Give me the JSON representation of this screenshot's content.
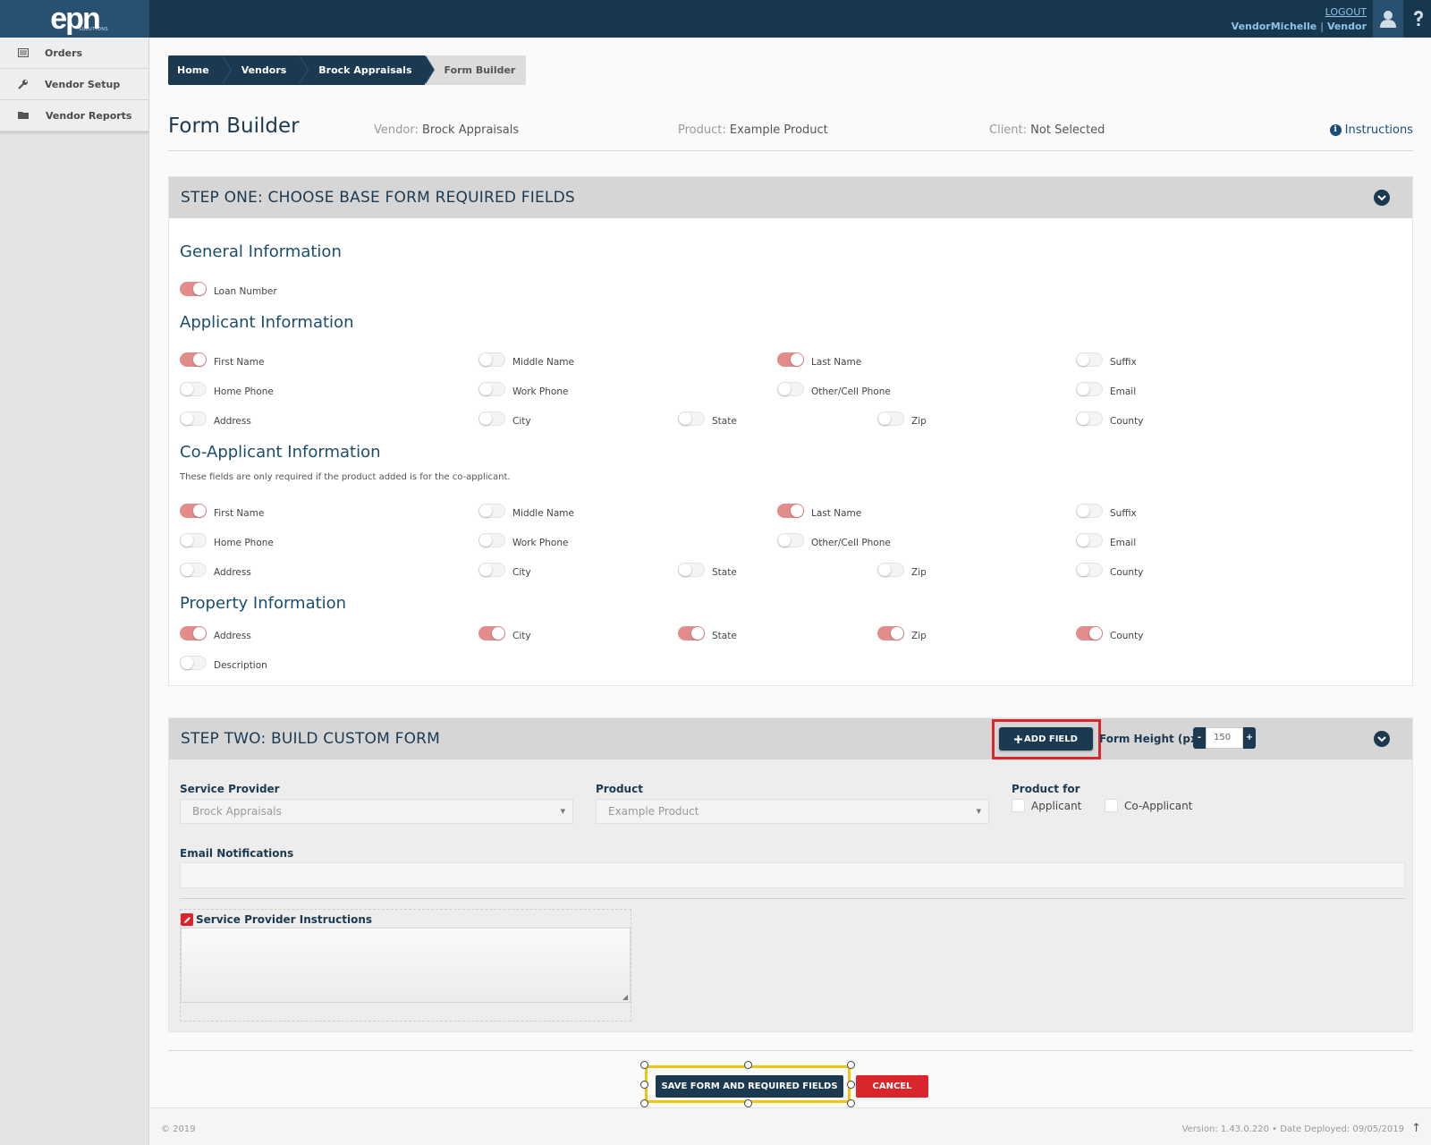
{
  "header": {
    "logo": "epn",
    "logo_sub": "SOLUTIONS",
    "logout": "LOGOUT",
    "user_name": "VendorMichelle",
    "user_sep": " | ",
    "user_role": "Vendor"
  },
  "sidebar": {
    "items": [
      {
        "label": "Orders",
        "icon": "orders-icon"
      },
      {
        "label": "Vendor Setup",
        "icon": "wrench-icon"
      },
      {
        "label": "Vendor Reports",
        "icon": "folder-icon"
      }
    ]
  },
  "breadcrumb": [
    "Home",
    "Vendors",
    "Brock Appraisals",
    "Form Builder"
  ],
  "page": {
    "title": "Form Builder",
    "vendor_key": "Vendor:",
    "vendor_val": "Brock Appraisals",
    "product_key": "Product:",
    "product_val": "Example Product",
    "client_key": "Client:",
    "client_val": "Not Selected",
    "instructions": "Instructions"
  },
  "step_one": {
    "title": "STEP ONE: CHOOSE BASE FORM REQUIRED FIELDS",
    "general": {
      "title": "General Information",
      "fields": [
        {
          "label": "Loan Number",
          "on": true
        }
      ]
    },
    "applicant": {
      "title": "Applicant Information",
      "fields": [
        {
          "label": "First Name",
          "on": true
        },
        {
          "label": "Middle Name",
          "on": false
        },
        {
          "label": "Last Name",
          "on": true
        },
        {
          "label": "Suffix",
          "on": false
        },
        {
          "label": "Home Phone",
          "on": false
        },
        {
          "label": "Work Phone",
          "on": false
        },
        {
          "label": "Other/Cell Phone",
          "on": false
        },
        {
          "label": "Email",
          "on": false
        },
        {
          "label": "Address",
          "on": false
        },
        {
          "label": "City",
          "on": false
        },
        {
          "label": "State",
          "on": false
        },
        {
          "label": "Zip",
          "on": false
        },
        {
          "label": "County",
          "on": false
        }
      ]
    },
    "coapplicant": {
      "title": "Co-Applicant Information",
      "note": "These fields are only required if the product added is for the co-applicant.",
      "fields": [
        {
          "label": "First Name",
          "on": true
        },
        {
          "label": "Middle Name",
          "on": false
        },
        {
          "label": "Last Name",
          "on": true
        },
        {
          "label": "Suffix",
          "on": false
        },
        {
          "label": "Home Phone",
          "on": false
        },
        {
          "label": "Work Phone",
          "on": false
        },
        {
          "label": "Other/Cell Phone",
          "on": false
        },
        {
          "label": "Email",
          "on": false
        },
        {
          "label": "Address",
          "on": false
        },
        {
          "label": "City",
          "on": false
        },
        {
          "label": "State",
          "on": false
        },
        {
          "label": "Zip",
          "on": false
        },
        {
          "label": "County",
          "on": false
        }
      ]
    },
    "property": {
      "title": "Property Information",
      "fields": [
        {
          "label": "Address",
          "on": true
        },
        {
          "label": "City",
          "on": true
        },
        {
          "label": "State",
          "on": true
        },
        {
          "label": "Zip",
          "on": true
        },
        {
          "label": "County",
          "on": true
        },
        {
          "label": "Description",
          "on": false
        }
      ]
    }
  },
  "step_two": {
    "title": "STEP TWO: BUILD CUSTOM FORM",
    "add_field": "ADD FIELD",
    "form_height_label": "Form Height (px):",
    "form_height_value": "150",
    "minus": "-",
    "plus": "+",
    "service_provider_label": "Service Provider",
    "service_provider_value": "Brock Appraisals",
    "product_label": "Product",
    "product_value": "Example Product",
    "product_for_label": "Product for",
    "product_for_options": [
      "Applicant",
      "Co-Applicant"
    ],
    "email_label": "Email Notifications",
    "instructions_label": "Service Provider Instructions"
  },
  "actions": {
    "save": "SAVE FORM AND REQUIRED FIELDS",
    "cancel": "CANCEL"
  },
  "footer": {
    "copyright": "© 2019",
    "version": "Version: 1.43.0.220  •  Date Deployed: 09/05/2019"
  },
  "colors": {
    "navy": "#1b3a52",
    "toggle_on": "#e38c8c",
    "highlight_red": "#d9252b",
    "highlight_yellow": "#f1c40f"
  }
}
